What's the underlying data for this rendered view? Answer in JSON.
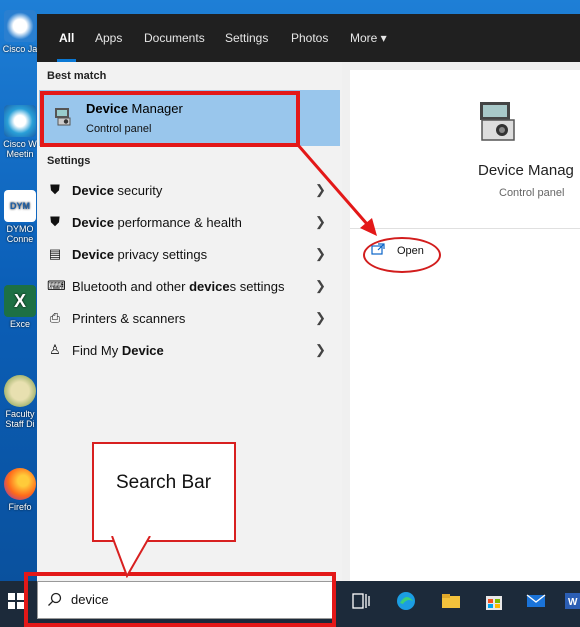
{
  "desktop": {
    "icons": [
      "Cisco Ja",
      "Cisco W\nMeetin",
      "DYMO\nConne",
      "Exce",
      "Faculty\nStaff Di",
      "Firefo"
    ]
  },
  "tabs": [
    "All",
    "Apps",
    "Documents",
    "Settings",
    "Photos",
    "More ▾"
  ],
  "best_match_header": "Best match",
  "best_match": {
    "title_bold": "Device",
    "title_rest": " Manager",
    "subtitle": "Control panel"
  },
  "settings_header": "Settings",
  "settings_items": [
    {
      "bold": "Device",
      "rest": " security"
    },
    {
      "bold": "Device",
      "rest": " performance & health"
    },
    {
      "bold": "Device",
      "rest": " privacy settings"
    },
    {
      "pre": "Bluetooth and other ",
      "bold": "device",
      "rest": "s settings"
    },
    {
      "pre": "Printers & scanners",
      "bold": "",
      "rest": ""
    },
    {
      "pre": "Find My ",
      "bold": "Device",
      "rest": ""
    }
  ],
  "detail": {
    "title": "Device Manag",
    "subtitle": "Control panel",
    "action": "Open"
  },
  "search": {
    "value": "device"
  },
  "annotation": {
    "callout": "Search Bar"
  },
  "colors": {
    "accent": "#0a78d4",
    "highlight": "#99c6ec",
    "annotation_red": "#e31818"
  }
}
